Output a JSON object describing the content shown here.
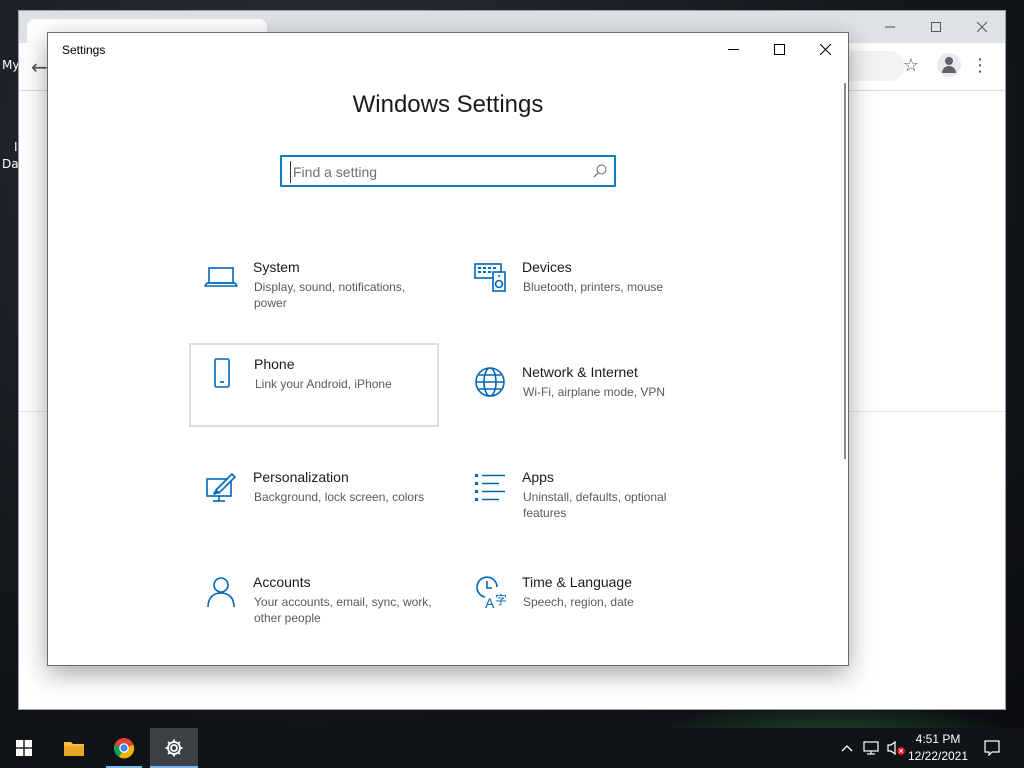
{
  "desktop": {
    "label_1": "My",
    "label_2": "Da",
    "label_3": "I"
  },
  "chrome": {
    "window_controls": [
      "minimize-icon",
      "maximize-icon",
      "close-icon"
    ]
  },
  "settings_window": {
    "title": "Settings",
    "heading": "Windows Settings",
    "search": {
      "placeholder": "Find a setting",
      "value": ""
    },
    "tiles": [
      {
        "title": "System",
        "desc": "Display, sound, notifications, power",
        "icon": "laptop-icon"
      },
      {
        "title": "Devices",
        "desc": "Bluetooth, printers, mouse",
        "icon": "devices-icon"
      },
      {
        "title": "Phone",
        "desc": "Link your Android, iPhone",
        "icon": "phone-icon"
      },
      {
        "title": "Network & Internet",
        "desc": "Wi-Fi, airplane mode, VPN",
        "icon": "globe-icon"
      },
      {
        "title": "Personalization",
        "desc": "Background, lock screen, colors",
        "icon": "paint-icon"
      },
      {
        "title": "Apps",
        "desc": "Uninstall, defaults, optional features",
        "icon": "apps-list-icon"
      },
      {
        "title": "Accounts",
        "desc": "Your accounts, email, sync, work, other people",
        "icon": "person-icon"
      },
      {
        "title": "Time & Language",
        "desc": "Speech, region, date",
        "icon": "time-language-icon"
      }
    ]
  },
  "taskbar": {
    "time": "4:51 PM",
    "date": "12/22/2021"
  },
  "colors": {
    "accent": "#0a7fc1",
    "icon_blue": "#0067b8",
    "taskbar": "#111417"
  }
}
